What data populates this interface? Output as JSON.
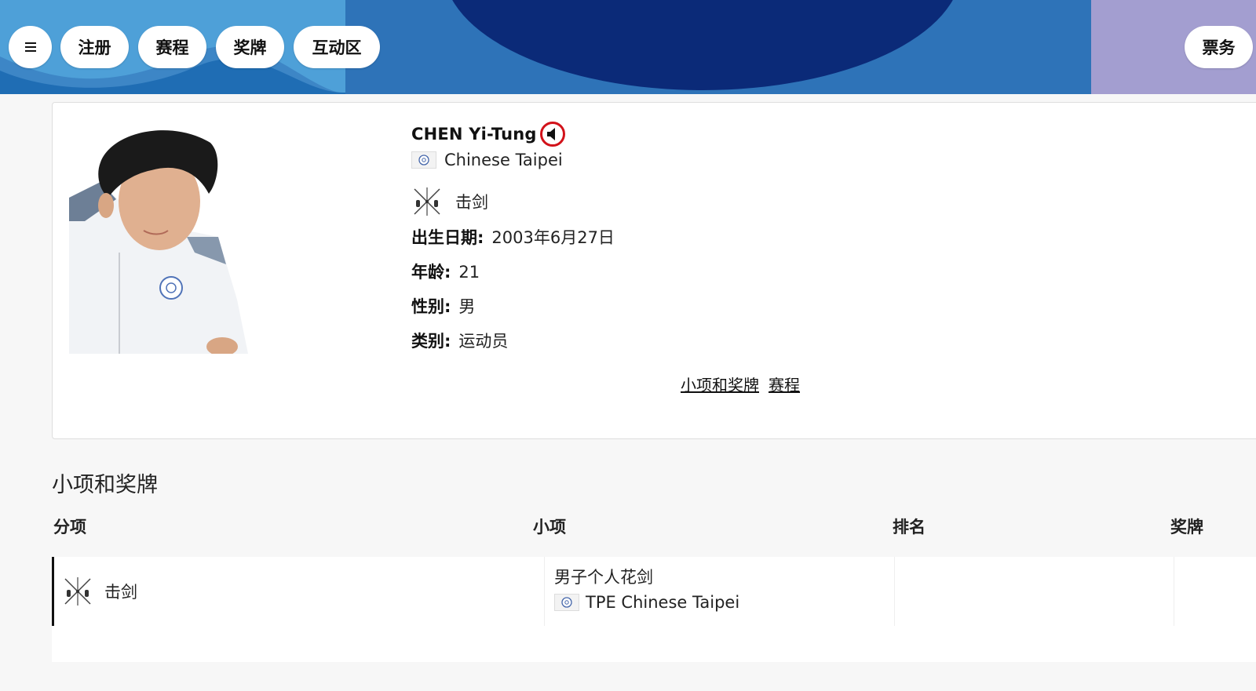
{
  "header": {
    "menu_icon": "hamburger-menu-icon",
    "nav": [
      "注册",
      "赛程",
      "奖牌",
      "互动区"
    ],
    "tickets": "票务",
    "colors": {
      "light_blue": "#3d86c6",
      "wave_blue": "#5aa9dc",
      "dark_navy": "#0b2a78",
      "lavender": "#a39ed0"
    }
  },
  "profile": {
    "name": "CHEN Yi-Tung",
    "speaker_icon": "speaker-icon",
    "country": "Chinese Taipei",
    "flag_icon": "chinese-taipei-olympic-flag-icon",
    "sport_icon": "fencing-pictogram-icon",
    "sport": "击剑",
    "fields": [
      {
        "label": "出生日期:",
        "value": "2003年6月27日"
      },
      {
        "label": "年龄:",
        "value": "21"
      },
      {
        "label": "性别:",
        "value": "男"
      },
      {
        "label": "类别:",
        "value": "运动员"
      }
    ],
    "links": [
      "小项和奖牌",
      "赛程"
    ],
    "accent_red": "#d2121a"
  },
  "events": {
    "title": "小项和奖牌",
    "columns": [
      "分项",
      "小项",
      "排名",
      "奖牌"
    ],
    "rows": [
      {
        "discipline": "击剑",
        "discipline_icon": "fencing-pictogram-icon",
        "event": "男子个人花剑",
        "team": "TPE Chinese Taipei",
        "rank": "",
        "medal": ""
      }
    ]
  }
}
